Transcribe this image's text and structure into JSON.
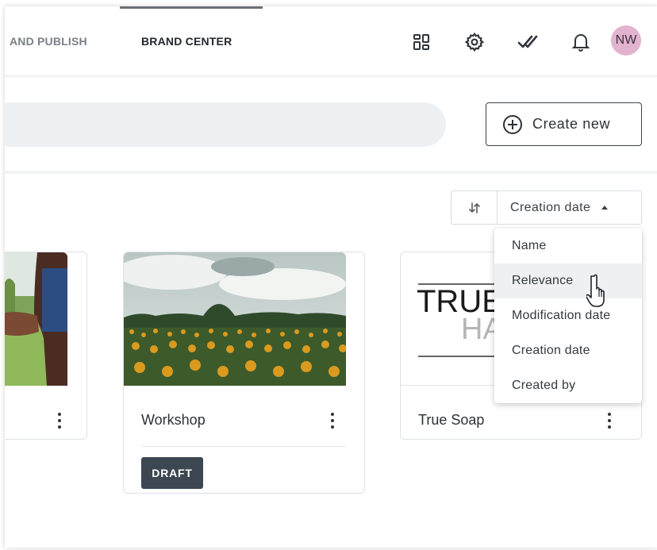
{
  "header": {
    "tabs": [
      {
        "label": "AND PUBLISH"
      },
      {
        "label": "BRAND CENTER",
        "active": true
      }
    ],
    "icons": [
      "apps-grid-icon",
      "gear-icon",
      "double-check-icon",
      "bell-icon"
    ],
    "avatar_initials": "NW",
    "avatar_color": "#e2b3cf"
  },
  "toolbar": {
    "create_label": "Create new"
  },
  "sort": {
    "current": "Creation date",
    "options": [
      {
        "label": "Name"
      },
      {
        "label": "Relevance",
        "hovered": true
      },
      {
        "label": "Modification date"
      },
      {
        "label": "Creation date"
      },
      {
        "label": "Created by"
      }
    ]
  },
  "cards": [
    {
      "title": "",
      "thumbnail": "people-photo"
    },
    {
      "title": "Workshop",
      "thumbnail": "sunflower-field-photo",
      "badge": "DRAFT"
    },
    {
      "title": "True Soap",
      "thumbnail": "true-soap-logo",
      "logo_text": "TRUE",
      "logo_subtext": "HA"
    }
  ],
  "colors": {
    "badge_bg": "#3c4752",
    "stack_shadow": "#c5ced8",
    "search_bg": "#eef1f4"
  }
}
